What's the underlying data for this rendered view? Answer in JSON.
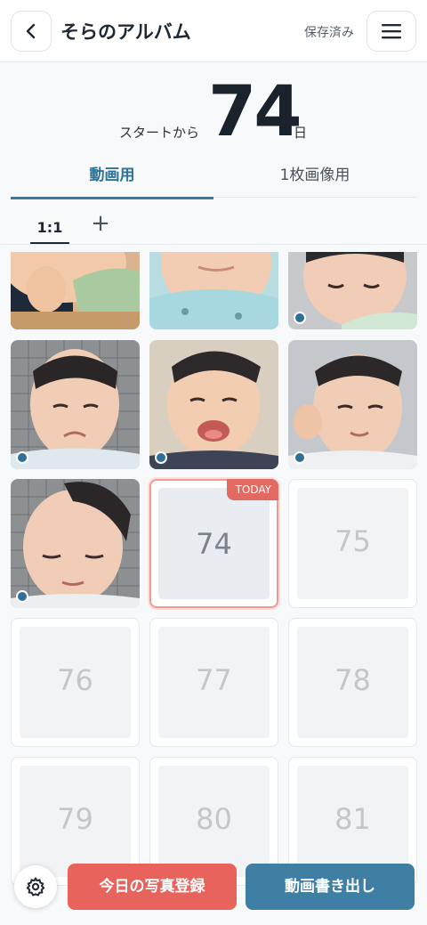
{
  "header": {
    "title": "そらのアルバム",
    "saved_label": "保存済み"
  },
  "counter": {
    "prefix": "スタートから",
    "days": "74",
    "unit": "日"
  },
  "tabs": [
    {
      "label": "動画用",
      "active": true
    },
    {
      "label": "1枚画像用",
      "active": false
    }
  ],
  "ratio": {
    "selected": "1:1",
    "add_symbol": "+"
  },
  "grid": {
    "today_badge": "TODAY",
    "today_day": "74",
    "empty_days": [
      "75",
      "76",
      "77",
      "78",
      "79",
      "80",
      "81"
    ]
  },
  "footer": {
    "register_label": "今日の写真登録",
    "export_label": "動画書き出し"
  },
  "colors": {
    "accent": "#3e7fa3",
    "register": "#e8635c",
    "today_badge": "#e26a62"
  }
}
